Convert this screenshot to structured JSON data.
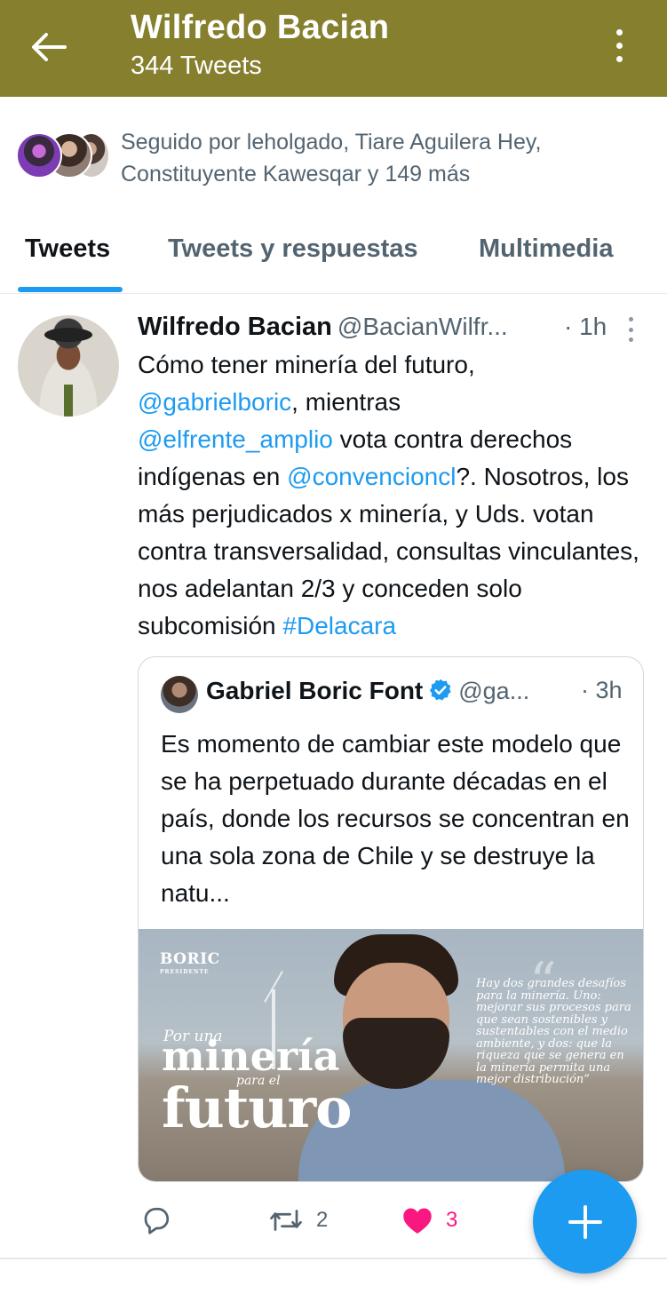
{
  "header": {
    "title": "Wilfredo Bacian",
    "subtitle": "344 Tweets",
    "back_icon": "arrow-left-icon",
    "more_icon": "more-vertical-icon",
    "background_color": "#857f2e"
  },
  "followers": {
    "text": "Seguido por leholgado, Tiare Aguilera Hey, Constituyente Kawesqar y 149 más"
  },
  "tabs": [
    {
      "label": "Tweets",
      "active": true
    },
    {
      "label": "Tweets y respuestas",
      "active": false
    },
    {
      "label": "Multimedia",
      "active": false
    }
  ],
  "tweet": {
    "name": "Wilfredo Bacian",
    "handle": "@BacianWilfr...",
    "time": "· 1h",
    "body": {
      "p1": "Cómo tener minería del futuro,",
      "m1": "@gabrielboric",
      "p2": ", mientras",
      "m2": "@elfrente_amplio",
      "p3": " vota contra derechos indígenas en ",
      "m3": "@convencioncl",
      "p4": "?. Nosotros, los más perjudicados x minería, y Uds. votan contra transversalidad, consultas vinculantes, nos adelantan 2/3 y conceden solo subcomisión ",
      "hashtag": "#Delacara"
    },
    "quote": {
      "name": "Gabriel Boric Font",
      "handle": "@ga...",
      "time": "· 3h",
      "verified": true,
      "body": "Es momento de cambiar este modelo que se ha perpetuado durante décadas en el país, donde los recursos se concentran en una sola zona de Chile y se destruye la natu...",
      "image": {
        "brand": "BORIC",
        "brand_sub": "PRESIDENTE",
        "slogan_top": "Por una",
        "slogan_big1": "minería",
        "slogan_small": "para el",
        "slogan_big2": "futuro",
        "quote_mark": "“",
        "quote_text": "Hay dos grandes desafíos para la minería. Uno: mejorar sus procesos para que sean sostenibles y sustentables con el medio ambiente, y dos: que la riqueza que se genera en la minería permita una mejor distribución”"
      }
    },
    "actions": {
      "reply_icon": "reply-bubble-icon",
      "retweet_icon": "retweet-icon",
      "retweets": "2",
      "like_icon": "heart-icon",
      "likes": "3",
      "like_color": "#f91880"
    }
  },
  "fab": {
    "icon": "plus-icon",
    "color": "#1d9bf0"
  }
}
